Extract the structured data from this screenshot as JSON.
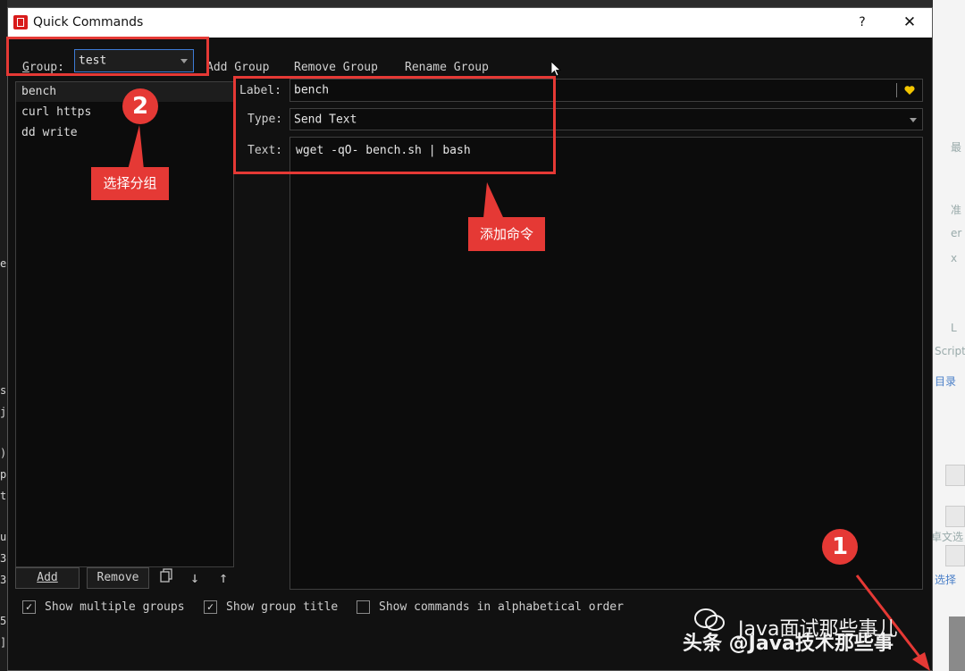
{
  "window": {
    "title": "Quick Commands",
    "help": "?",
    "close": "✕",
    "accent": "#e53935"
  },
  "toolbar": {
    "group_label": "Group:",
    "group_value": "test",
    "add_group": "Add Group",
    "remove_group": "Remove Group",
    "rename_group": "Rename Group"
  },
  "commands": [
    "bench",
    "curl https",
    "dd write"
  ],
  "editor": {
    "label_label": "Label:",
    "label_value": "bench",
    "type_label": "Type:",
    "type_value": "Send Text",
    "text_label": "Text:",
    "text_value": "wget -qO- bench.sh | bash"
  },
  "buttons": {
    "add": "Add",
    "remove": "Remove"
  },
  "options": [
    {
      "label": "Show multiple groups",
      "checked": true
    },
    {
      "label": "Show group title",
      "checked": true
    },
    {
      "label": "Show commands in alphabetical order",
      "checked": false
    }
  ],
  "annotations": {
    "badge_1": "1",
    "badge_2": "2",
    "callout_group": "选择分组",
    "callout_command": "添加命令"
  },
  "watermark": {
    "line1": "Java面试那些事儿",
    "line2": "头条 @Java技术那些事"
  },
  "background": {
    "right_texts": [
      "最",
      "准",
      "er",
      "x",
      "L",
      "Script",
      "目录",
      "卓文选",
      "选择"
    ],
    "left_texts": [
      "e",
      "s",
      "j",
      ")",
      "p",
      "t",
      "u",
      "3",
      "3",
      "5",
      "]"
    ]
  }
}
